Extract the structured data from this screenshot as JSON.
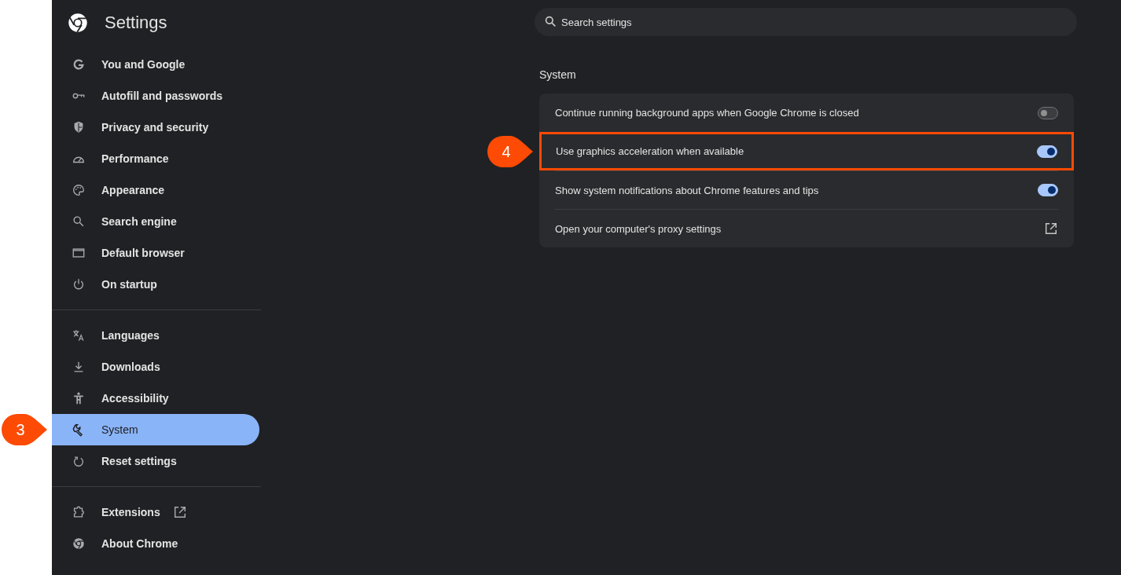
{
  "header": {
    "title": "Settings"
  },
  "search": {
    "placeholder": "Search settings"
  },
  "sidebar": {
    "groups": [
      {
        "items": [
          {
            "label": "You and Google",
            "kind": "page",
            "selected": false
          },
          {
            "label": "Autofill and passwords",
            "kind": "page",
            "selected": false
          },
          {
            "label": "Privacy and security",
            "kind": "page",
            "selected": false
          },
          {
            "label": "Performance",
            "kind": "page",
            "selected": false
          },
          {
            "label": "Appearance",
            "kind": "page",
            "selected": false
          },
          {
            "label": "Search engine",
            "kind": "page",
            "selected": false
          },
          {
            "label": "Default browser",
            "kind": "page",
            "selected": false
          },
          {
            "label": "On startup",
            "kind": "page",
            "selected": false
          }
        ]
      },
      {
        "items": [
          {
            "label": "Languages",
            "kind": "page",
            "selected": false
          },
          {
            "label": "Downloads",
            "kind": "page",
            "selected": false
          },
          {
            "label": "Accessibility",
            "kind": "page",
            "selected": false
          },
          {
            "label": "System",
            "kind": "page",
            "selected": true,
            "callout": "3"
          },
          {
            "label": "Reset settings",
            "kind": "page",
            "selected": false
          }
        ]
      },
      {
        "items": [
          {
            "label": "Extensions",
            "kind": "external",
            "selected": false
          },
          {
            "label": "About Chrome",
            "kind": "page",
            "selected": false
          }
        ]
      }
    ]
  },
  "section": {
    "title": "System",
    "rows": [
      {
        "label": "Continue running background apps when Google Chrome is closed",
        "kind": "toggle",
        "on": false,
        "highlighted": false
      },
      {
        "label": "Use graphics acceleration when available",
        "kind": "toggle",
        "on": true,
        "highlighted": true,
        "callout": "4"
      },
      {
        "label": "Show system notifications about Chrome features and tips",
        "kind": "toggle",
        "on": true,
        "highlighted": false
      },
      {
        "label": "Open your computer's proxy settings",
        "kind": "external",
        "highlighted": false
      }
    ]
  }
}
